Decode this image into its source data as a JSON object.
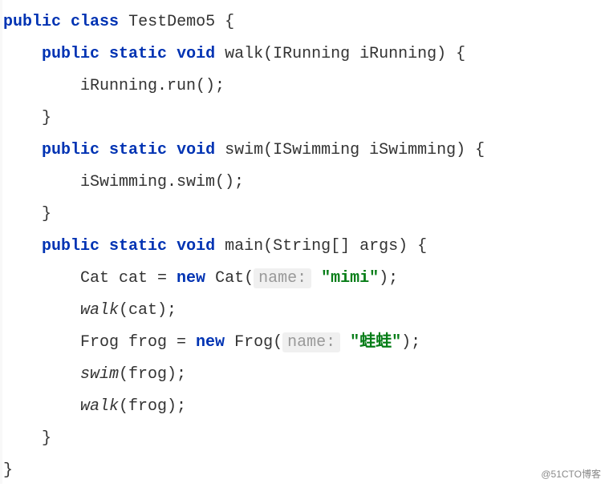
{
  "code": {
    "kw_public": "public",
    "kw_class": "class",
    "kw_static": "static",
    "kw_void": "void",
    "kw_new": "new",
    "class_name": "TestDemo5",
    "method1_name": "walk",
    "method1_params": "(IRunning iRunning) {",
    "method1_body": "iRunning.run();",
    "method2_name": "swim",
    "method2_params": "(ISwimming iSwimming) {",
    "method2_body": "iSwimming.swim();",
    "main_name": "main",
    "main_params": "(String[] args) {",
    "cat_decl_pre": "Cat cat = ",
    "cat_ctor": " Cat(",
    "hint_name": "name:",
    "cat_str": "\"mimi\"",
    "cat_close": ");",
    "walk_cat": "walk",
    "walk_cat_args": "(cat);",
    "frog_decl_pre": "Frog frog = ",
    "frog_ctor": " Frog(",
    "frog_str": "\"蛙蛙\"",
    "frog_close": ");",
    "swim_frog": "swim",
    "swim_frog_args": "(frog);",
    "walk_frog": "walk",
    "walk_frog_args": "(frog);",
    "brace_open": " {",
    "brace_close": "}"
  },
  "watermark": "@51CTO博客"
}
